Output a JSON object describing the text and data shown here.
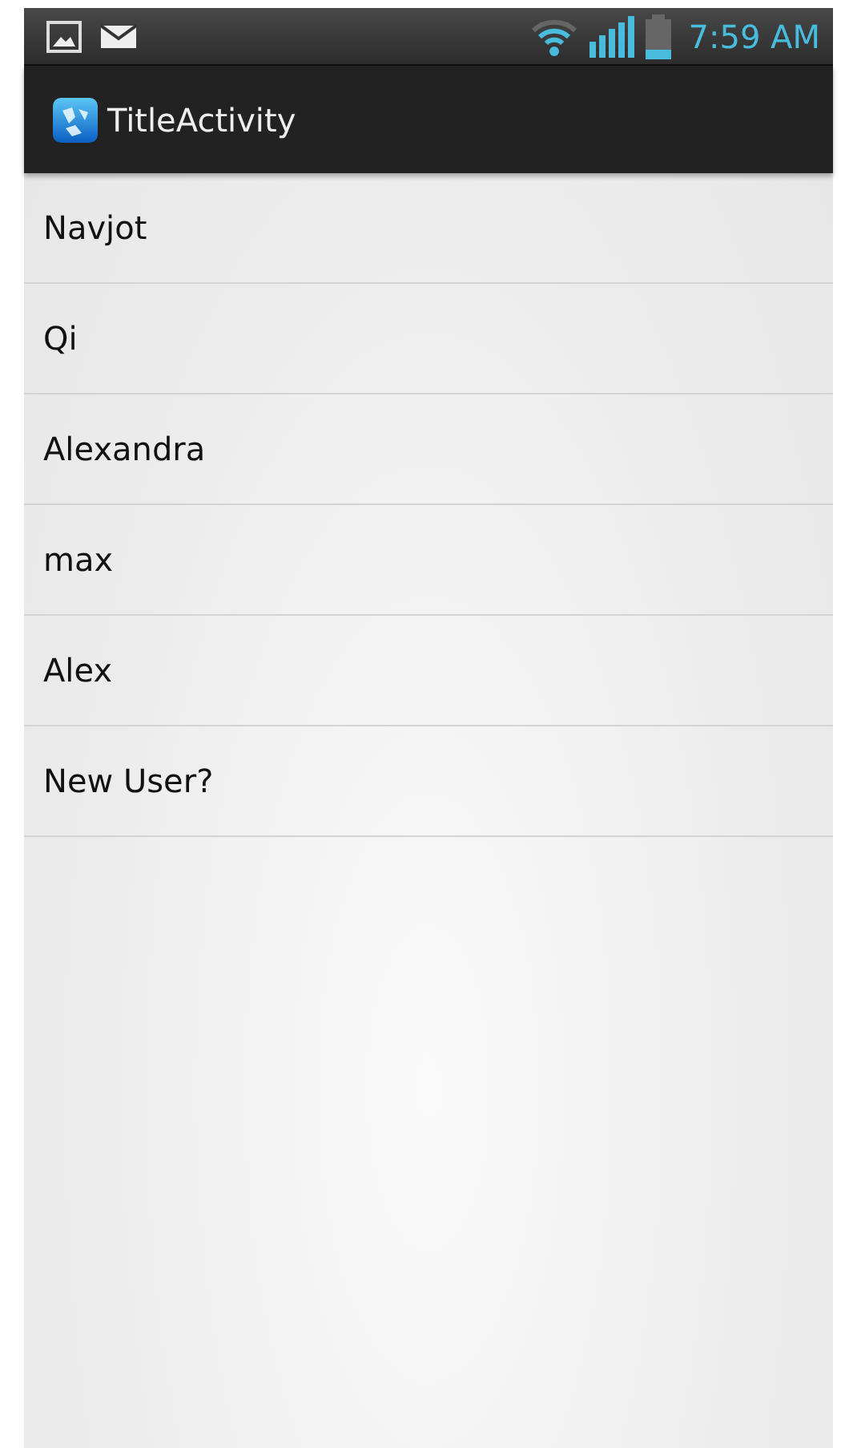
{
  "status_bar": {
    "time": "7:59 AM"
  },
  "action_bar": {
    "title": "TitleActivity"
  },
  "list": {
    "items": [
      {
        "label": "Navjot"
      },
      {
        "label": "Qi"
      },
      {
        "label": "Alexandra"
      },
      {
        "label": "max"
      },
      {
        "label": "Alex"
      },
      {
        "label": "New User?"
      }
    ]
  }
}
